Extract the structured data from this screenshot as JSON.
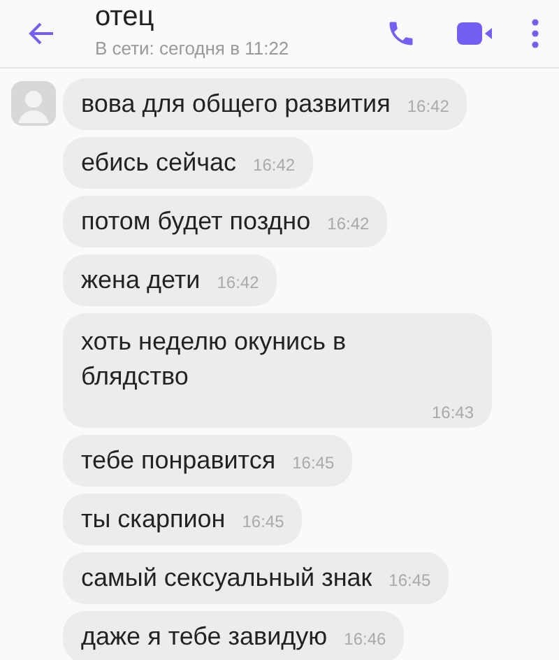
{
  "header": {
    "title": "отец",
    "status": "В сети: сегодня в 11:22"
  },
  "messages": [
    {
      "text": "вова для общего развития",
      "time": "16:42",
      "avatar": true,
      "kind": "inline"
    },
    {
      "text": "ебись сейчас",
      "time": "16:42",
      "avatar": false,
      "kind": "inline"
    },
    {
      "text": "потом будет поздно",
      "time": "16:42",
      "avatar": false,
      "kind": "inline"
    },
    {
      "text": "жена дети",
      "time": "16:42",
      "avatar": false,
      "kind": "inline"
    },
    {
      "text": "хоть неделю окунись в блядство",
      "time": "16:43",
      "avatar": false,
      "kind": "block"
    },
    {
      "text": "тебе понравится",
      "time": "16:45",
      "avatar": false,
      "kind": "inline"
    },
    {
      "text": "ты скарпион",
      "time": "16:45",
      "avatar": false,
      "kind": "inline"
    },
    {
      "text": "самый сексуальный знак",
      "time": "16:45",
      "avatar": false,
      "kind": "inline"
    },
    {
      "text": "даже я тебе завидую",
      "time": "16:46",
      "avatar": false,
      "kind": "inline"
    }
  ]
}
